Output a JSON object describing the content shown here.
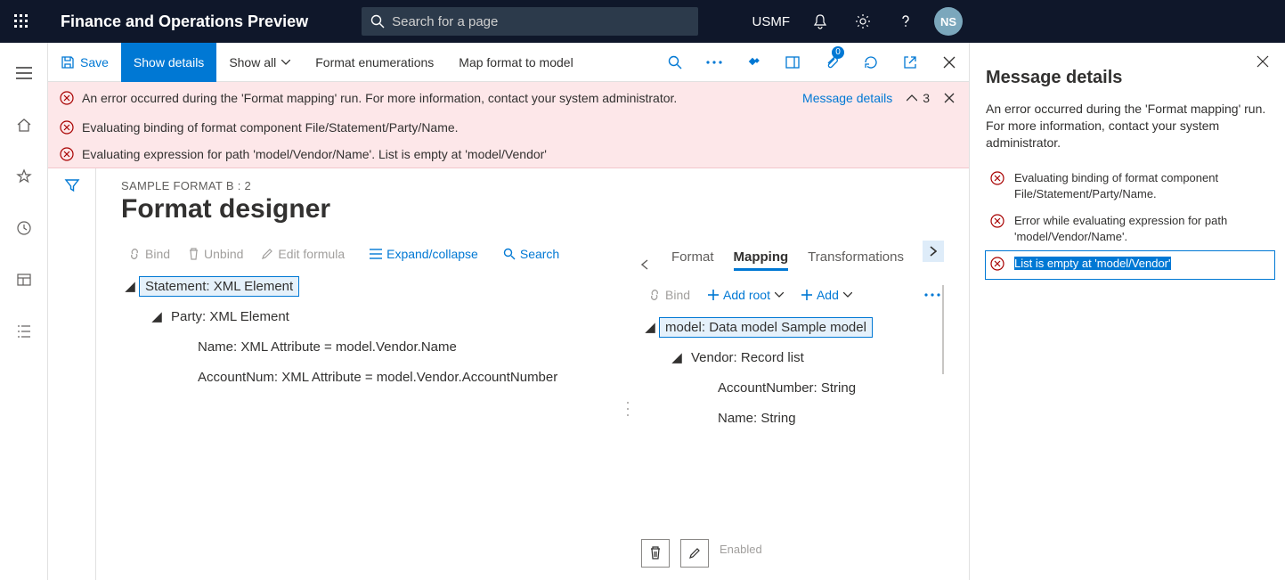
{
  "topnav": {
    "title": "Finance and Operations Preview",
    "search_placeholder": "Search for a page",
    "company": "USMF",
    "avatar": "NS"
  },
  "actionbar": {
    "save": "Save",
    "show_details": "Show details",
    "show_all": "Show all",
    "format_enum": "Format enumerations",
    "map_format_to_model": "Map format to model",
    "attachments_badge": "0"
  },
  "banner": {
    "rows": [
      "An error occurred during the 'Format mapping' run. For more information, contact your system administrator.",
      "Evaluating binding of format component File/Statement/Party/Name.",
      "Evaluating expression for path 'model/Vendor/Name'.   List is empty at 'model/Vendor'"
    ],
    "details_link": "Message details",
    "count": "3"
  },
  "page": {
    "crumb": "SAMPLE FORMAT B : 2",
    "title": "Format designer"
  },
  "left_toolbar": {
    "bind": "Bind",
    "unbind": "Unbind",
    "edit_formula": "Edit formula",
    "expand": "Expand/collapse",
    "search": "Search"
  },
  "left_tree": {
    "n0": "Statement: XML Element",
    "n1": "Party: XML Element",
    "n2": "Name: XML Attribute = model.Vendor.Name",
    "n3": "AccountNum: XML Attribute = model.Vendor.AccountNumber"
  },
  "right_tabs": {
    "format": "Format",
    "mapping": "Mapping",
    "transformations": "Transformations"
  },
  "right_toolbar": {
    "bind": "Bind",
    "add_root": "Add root",
    "add": "Add"
  },
  "right_tree": {
    "n0": "model: Data model Sample model",
    "n1": "Vendor: Record list",
    "n2": "AccountNumber: String",
    "n3": "Name: String"
  },
  "right_bottom": {
    "enabled": "Enabled"
  },
  "rightpane": {
    "title": "Message details",
    "body": "An error occurred during the 'Format mapping' run. For more information, contact your system administrator.",
    "items": [
      "Evaluating binding of format component File/Statement/Party/Name.",
      "Error while evaluating expression for path 'model/Vendor/Name'.",
      "List is empty at 'model/Vendor'"
    ]
  }
}
